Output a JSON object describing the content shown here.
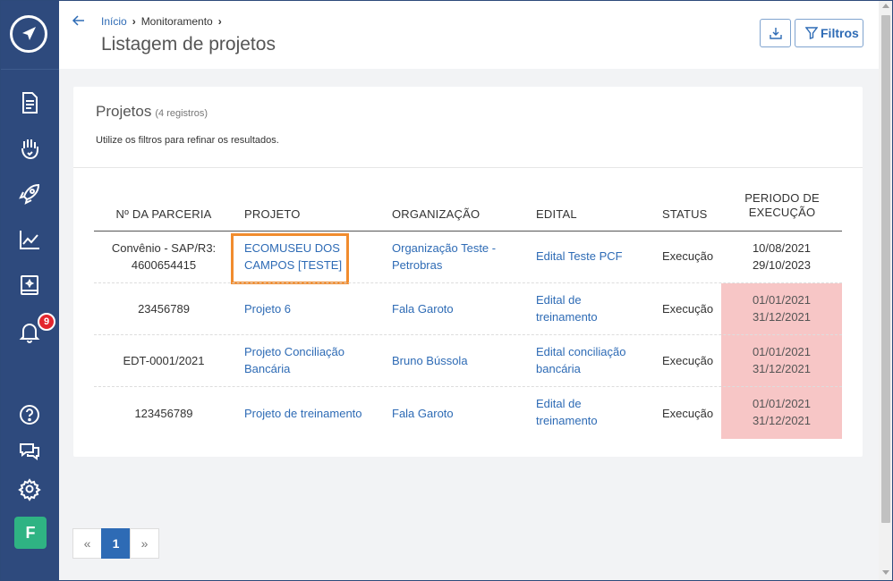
{
  "header": {
    "breadcrumb": [
      "Início",
      "Monitoramento"
    ],
    "title": "Listagem de projetos",
    "filter_label": "Filtros"
  },
  "sidebar": {
    "notification_count": "9",
    "avatar_initial": "F"
  },
  "card": {
    "title": "Projetos",
    "count": "(4 registros)",
    "description": "Utilize os filtros para refinar os resultados."
  },
  "table": {
    "columns": [
      "Nº DA PARCERIA",
      "PROJETO",
      "ORGANIZAÇÃO",
      "EDITAL",
      "STATUS",
      "PERIODO DE",
      "EXECUÇÃO"
    ],
    "rows": [
      {
        "parceria": [
          "Convênio - SAP/R3:",
          "4600654415"
        ],
        "projeto": [
          "ECOMUSEU DOS",
          "CAMPOS [TESTE]"
        ],
        "organizacao": [
          "Organização Teste -",
          "Petrobras"
        ],
        "edital": [
          "Edital Teste PCF"
        ],
        "status": "Execução",
        "periodo": [
          "10/08/2021",
          "29/10/2023"
        ]
      },
      {
        "parceria": [
          "23456789"
        ],
        "projeto": [
          "Projeto 6"
        ],
        "organizacao": [
          "Fala Garoto"
        ],
        "edital": [
          "Edital de",
          "treinamento"
        ],
        "status": "Execução",
        "periodo": [
          "01/01/2021",
          "31/12/2021"
        ]
      },
      {
        "parceria": [
          "EDT-0001/2021"
        ],
        "projeto": [
          "Projeto Conciliação",
          "Bancária"
        ],
        "organizacao": [
          "Bruno Bússola"
        ],
        "edital": [
          "Edital conciliação",
          "bancária"
        ],
        "status": "Execução",
        "periodo": [
          "01/01/2021",
          "31/12/2021"
        ]
      },
      {
        "parceria": [
          "123456789"
        ],
        "projeto": [
          "Projeto de treinamento"
        ],
        "organizacao": [
          "Fala Garoto"
        ],
        "edital": [
          "Edital de",
          "treinamento"
        ],
        "status": "Execução",
        "periodo": [
          "01/01/2021",
          "31/12/2021"
        ]
      }
    ]
  },
  "pagination": {
    "prev": "«",
    "current": "1",
    "next": "»"
  },
  "colors": {
    "sidebar": "#2e4a7d",
    "link": "#2e6bb5",
    "period_overdue": "#f7c6c6",
    "highlight": "#f18c2e",
    "avatar": "#2fb383",
    "badge": "#e3262e"
  }
}
